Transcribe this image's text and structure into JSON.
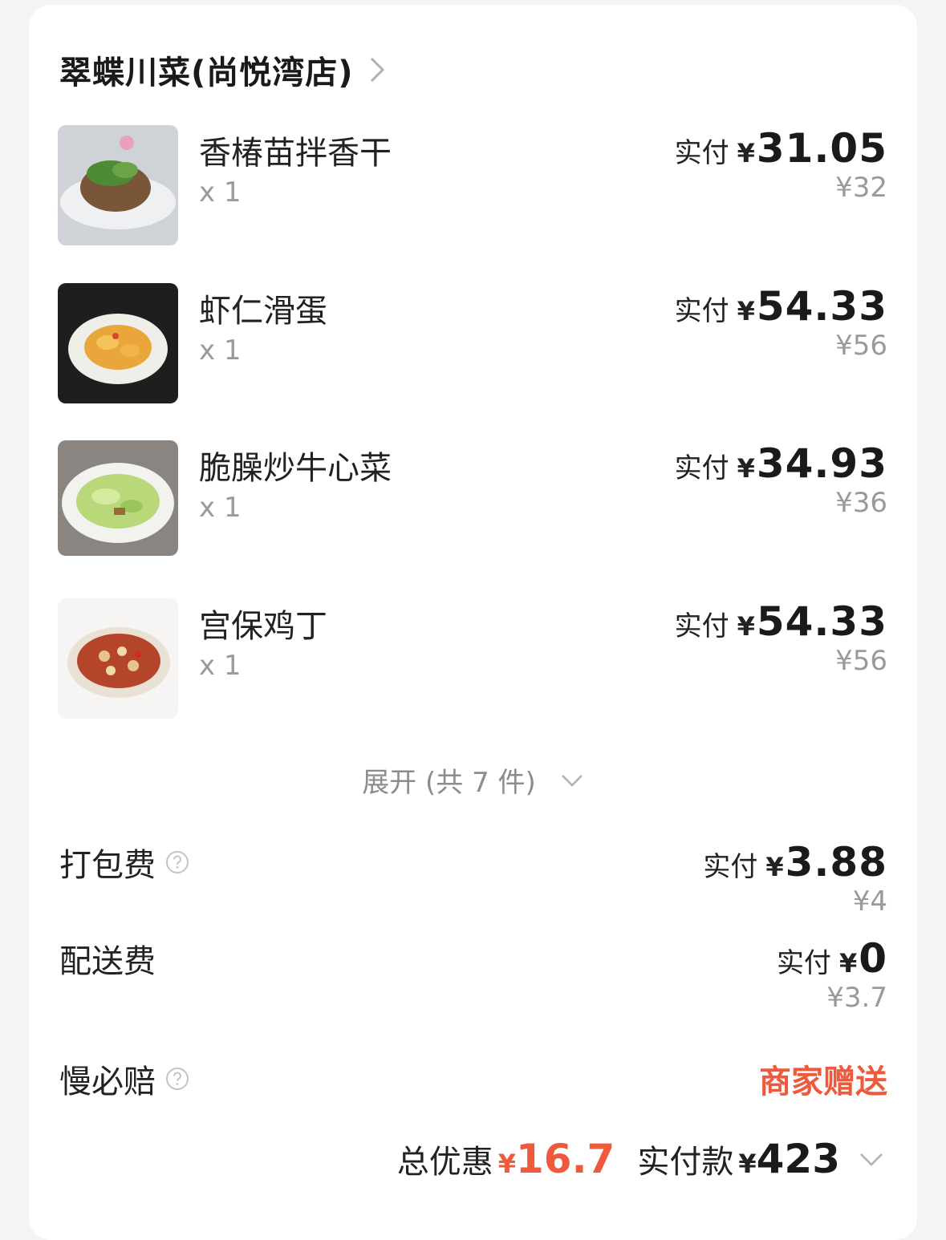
{
  "store": {
    "name": "翠蝶川菜(尚悦湾店)"
  },
  "items": [
    {
      "name": "香椿苗拌香干",
      "qty": "x 1",
      "paid_label": "实付",
      "yen": "¥",
      "paid": "31.05",
      "original": "¥32"
    },
    {
      "name": "虾仁滑蛋",
      "qty": "x 1",
      "paid_label": "实付",
      "yen": "¥",
      "paid": "54.33",
      "original": "¥56"
    },
    {
      "name": "脆臊炒牛心菜",
      "qty": "x 1",
      "paid_label": "实付",
      "yen": "¥",
      "paid": "34.93",
      "original": "¥36"
    },
    {
      "name": "宫保鸡丁",
      "qty": "x 1",
      "paid_label": "实付",
      "yen": "¥",
      "paid": "54.33",
      "original": "¥56"
    }
  ],
  "expand": {
    "label": "展开 (共 7 件)"
  },
  "fees": {
    "packing": {
      "label": "打包费",
      "paid_label": "实付",
      "yen": "¥",
      "paid": "3.88",
      "original": "¥4"
    },
    "delivery": {
      "label": "配送费",
      "paid_label": "实付",
      "yen": "¥",
      "paid": "0",
      "original": "¥3.7"
    },
    "late_guarantee": {
      "label": "慢必赔",
      "value": "商家赠送"
    }
  },
  "total": {
    "discount_label": "总优惠",
    "discount_yen": "¥",
    "discount": "16.7",
    "paid_label": "实付款",
    "paid_yen": "¥",
    "paid": "423"
  },
  "colors": {
    "accent": "#f05a3c",
    "text": "#222222",
    "muted": "#9a9a9a",
    "background": "#f4f4f4"
  }
}
